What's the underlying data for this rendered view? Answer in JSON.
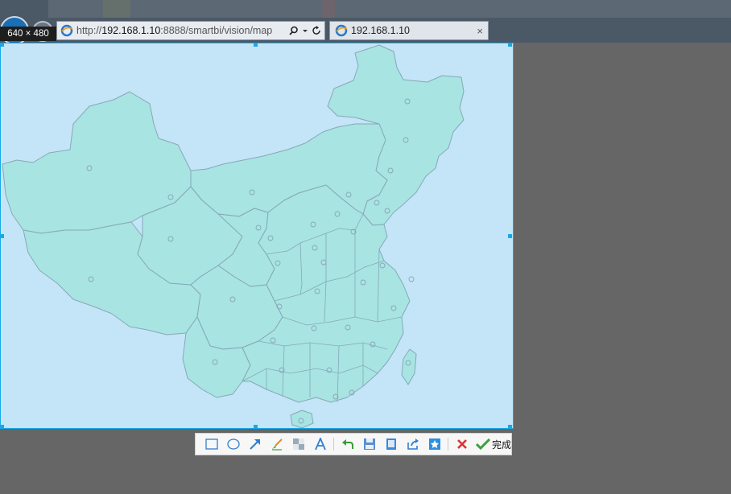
{
  "browser": {
    "address_prefix": "http://",
    "address_host": "192.168.1.10",
    "address_rest": ":8888/smartbi/vision/map",
    "tab_title": "192.168.1.10",
    "tab_close": "×"
  },
  "capture": {
    "size_label": "640 × 480",
    "map_fill": "#a8e4e2",
    "map_stroke": "#86a8b8",
    "background": "#c4e5f7",
    "selection_color": "#18a8e8"
  },
  "toolbar": {
    "tools": [
      "rectangle-icon",
      "ellipse-icon",
      "arrow-icon",
      "brush-icon",
      "mosaic-icon",
      "text-icon",
      "undo-icon",
      "save-icon",
      "copy-icon",
      "share-icon",
      "pin-icon",
      "cancel-icon"
    ],
    "done_label": "完成"
  }
}
